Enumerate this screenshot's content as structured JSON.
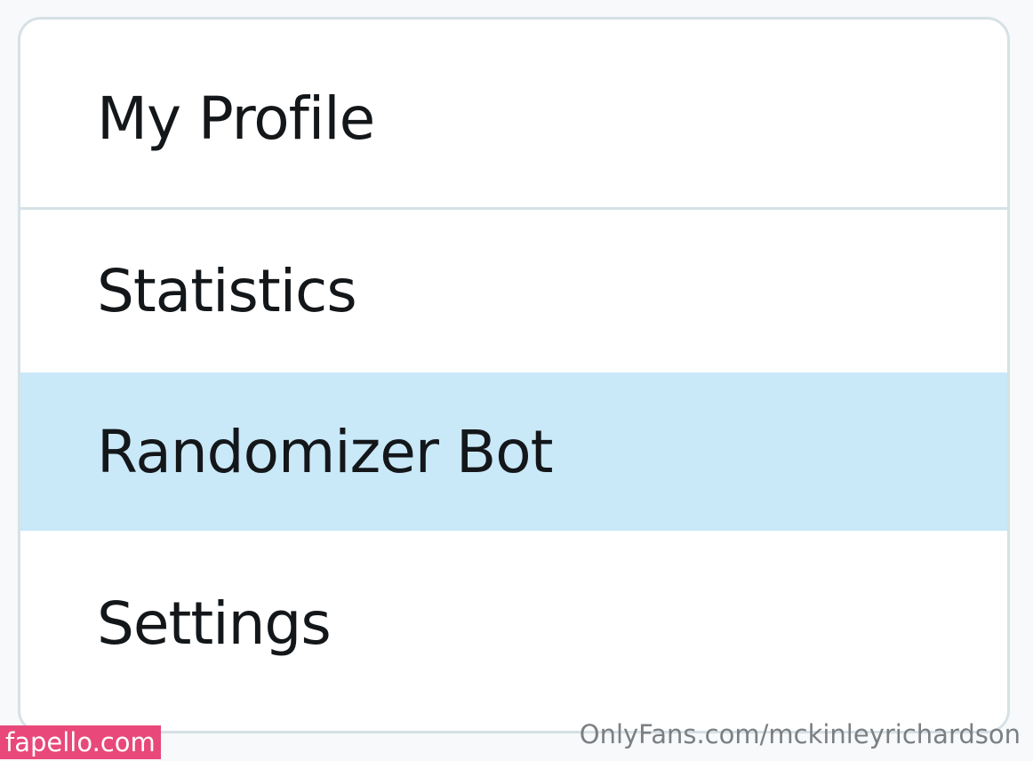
{
  "menu": {
    "items": [
      {
        "label": "My Profile",
        "selected": false
      },
      {
        "label": "Statistics",
        "selected": false
      },
      {
        "label": "Randomizer Bot",
        "selected": true
      },
      {
        "label": "Settings",
        "selected": false
      }
    ]
  },
  "watermarks": {
    "left": "fapello.com",
    "right": "OnlyFans.com/mckinleyrichardson"
  },
  "colors": {
    "selected_background": "#c9e8f8",
    "border": "#d6e1e6",
    "text": "#14171a",
    "watermark_left_bg": "#e8487a"
  }
}
